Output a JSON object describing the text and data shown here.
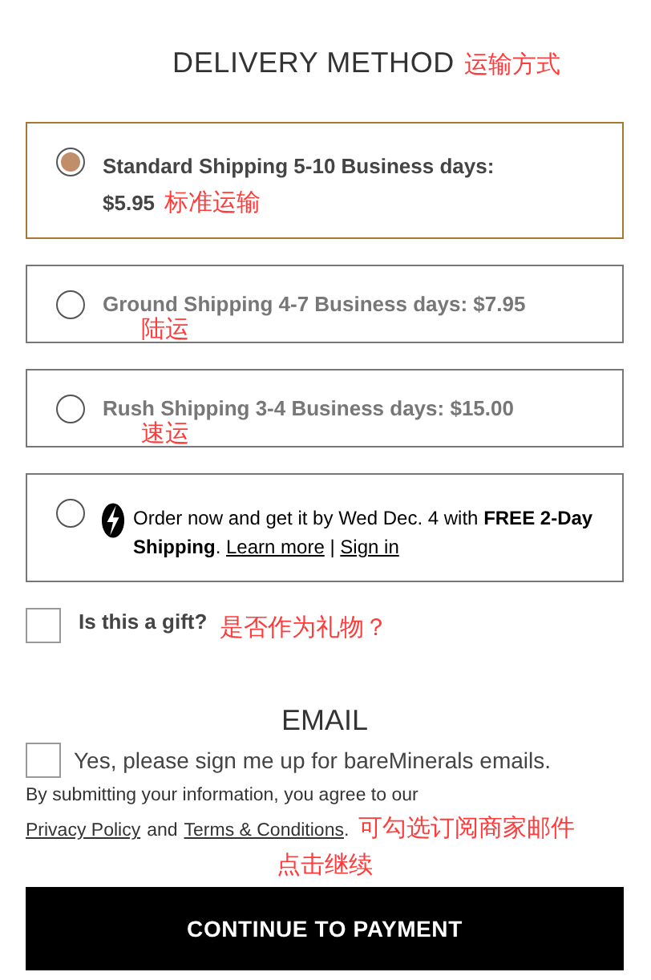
{
  "delivery": {
    "title": "DELIVERY METHOD",
    "note": "运输方式",
    "options": [
      {
        "kind": "wrapped",
        "selected": true,
        "label": "Standard Shipping 5-10 Business days:",
        "price": "$5.95",
        "note": "标准运输"
      },
      {
        "kind": "single",
        "selected": false,
        "label": "Ground Shipping 4-7 Business days: $7.95",
        "note": "陆运"
      },
      {
        "kind": "single",
        "selected": false,
        "label": "Rush Shipping 3-4 Business days: $15.00",
        "note": "速运"
      },
      {
        "kind": "promo",
        "selected": false,
        "text": "Order now and get it by Wed Dec. 4 with **FREE 2-Day Shipping**.",
        "links": [
          "Learn more",
          "Sign in"
        ],
        "separator": "|"
      }
    ]
  },
  "gift": {
    "label": "Is this a gift?",
    "checked": false,
    "note": "是否作为礼物？"
  },
  "email": {
    "title": "EMAIL",
    "checkbox_label": "Yes, please sign me up for bareMinerals emails.",
    "checked": false,
    "disclaimer": "By submitting your information, you agree to our",
    "privacy_link": "Privacy Policy",
    "and": "and",
    "terms_link": "Terms & Conditions",
    "end": ".",
    "note": "可勾选订阅商家邮件"
  },
  "continue": {
    "note": "点击继续",
    "button": "CONTINUE TO PAYMENT"
  }
}
